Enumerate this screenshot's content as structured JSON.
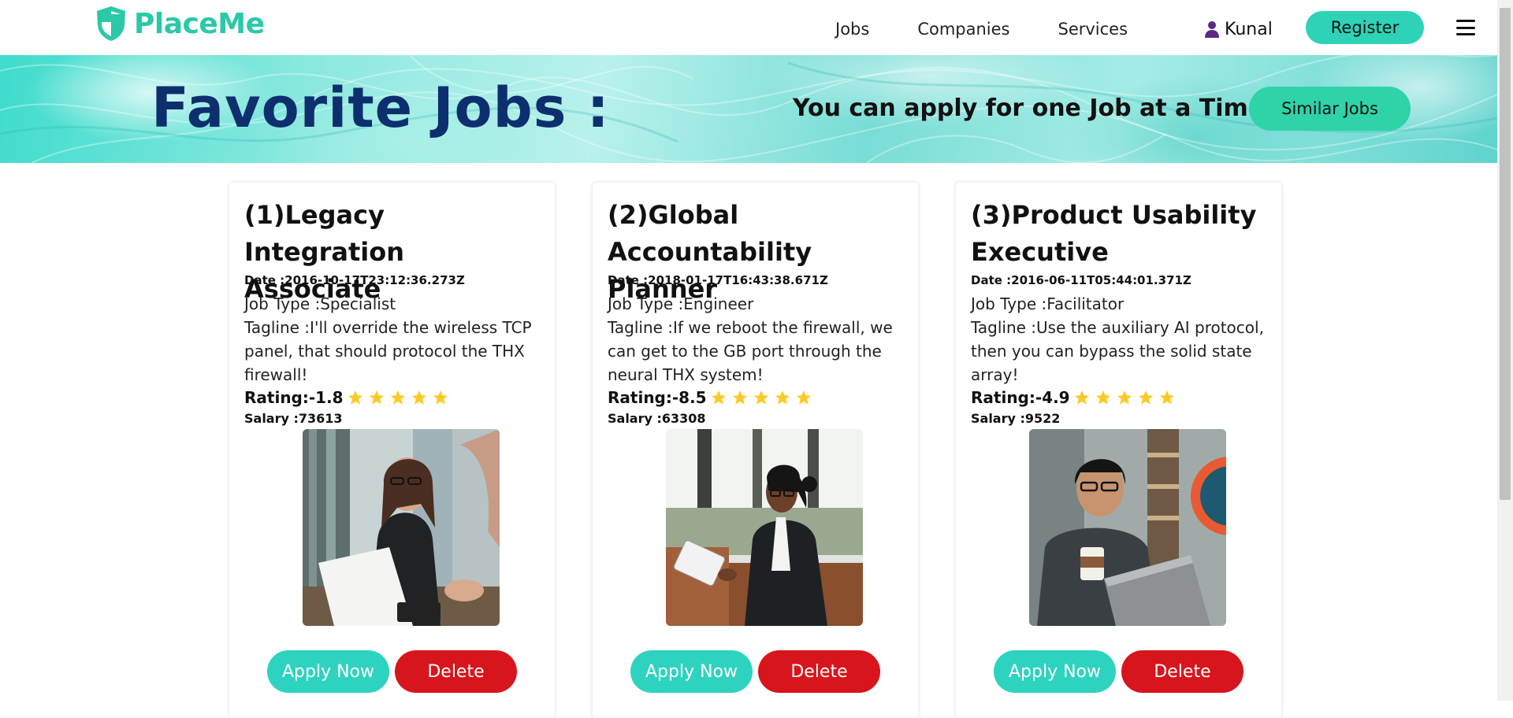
{
  "brand": {
    "name": "PlaceMe",
    "icon": "shield-icon",
    "color": "#2ac9a7"
  },
  "nav": {
    "links": [
      "Jobs",
      "Companies",
      "Services"
    ],
    "user": {
      "name": "Kunal",
      "icon": "user-icon"
    },
    "register_label": "Register",
    "menu_icon": "hamburger-menu-icon"
  },
  "hero": {
    "title": "Favorite Jobs :",
    "tagline": "You can apply for one Job at a Time",
    "similar_jobs_label": "Similar Jobs"
  },
  "colors": {
    "accent": "#2ed3b7",
    "delete": "#d8141c",
    "title": "#0e2f6e",
    "star": "#ffc928"
  },
  "cards": [
    {
      "title": "(1)Legacy Integration Associate",
      "date": "Date :2016-10-17T23:12:36.273Z",
      "job_type": "Job Type :Specialist",
      "tagline": "Tagline :I'll override the wireless TCP panel, that should protocol the THX firewall!",
      "rating": "Rating:-1.8",
      "stars": 5,
      "salary": "Salary :73613",
      "apply_label": "Apply Now",
      "delete_label": "Delete"
    },
    {
      "title": "(2)Global Accountability Planner",
      "date": "Date :2018-01-17T16:43:38.671Z",
      "job_type": "Job Type :Engineer",
      "tagline": "Tagline :If we reboot the firewall, we can get to the GB port through the neural THX system!",
      "rating": "Rating:-8.5",
      "stars": 5,
      "salary": "Salary :63308",
      "apply_label": "Apply Now",
      "delete_label": "Delete"
    },
    {
      "title": "(3)Product Usability Executive",
      "date": "Date :2016-06-11T05:44:01.371Z",
      "job_type": "Job Type :Facilitator",
      "tagline": "Tagline :Use the auxiliary AI protocol, then you can bypass the solid state array!",
      "rating": "Rating:-4.9",
      "stars": 5,
      "salary": "Salary :9522",
      "apply_label": "Apply Now",
      "delete_label": "Delete"
    }
  ]
}
